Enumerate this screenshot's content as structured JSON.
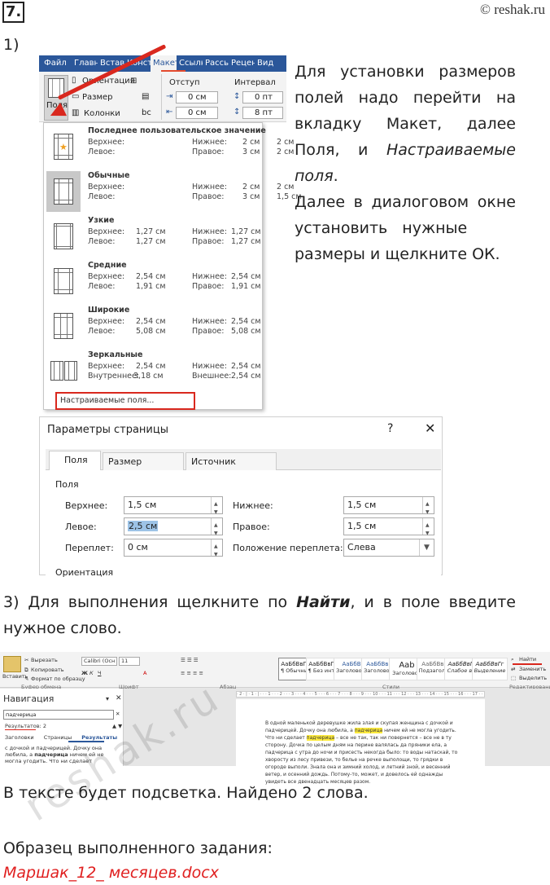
{
  "header": {
    "task_number": "7.",
    "site": "© reshak.ru"
  },
  "part1": {
    "label": "1)",
    "ribbon": {
      "tabs": [
        "Файл",
        "Главн",
        "Встав",
        "Конст",
        "Макет",
        "Ссылк",
        "Рассы",
        "Рецен",
        "Вид"
      ],
      "selected_tab": "Макет",
      "orientation": "Ориентация",
      "size": "Размер",
      "columns": "Колонки",
      "fields": "Поля",
      "indent": "Отступ",
      "spacing": "Интервал",
      "indent_left": "0 см",
      "indent_right": "0 см",
      "spacing_before": "0 пт",
      "spacing_after": "8 пт"
    },
    "margins_menu": {
      "items": [
        {
          "title": "Последнее пользовательское значение",
          "top_label": "Верхнее:",
          "top": "2 см",
          "bottom_label": "Нижнее:",
          "bottom": "2 см",
          "left_label": "Левое:",
          "left": "3 см",
          "right_label": "Правое:",
          "right": "2 см"
        },
        {
          "title": "Обычные",
          "top_label": "Верхнее:",
          "top": "2 см",
          "bottom_label": "Нижнее:",
          "bottom": "2 см",
          "left_label": "Левое:",
          "left": "3 см",
          "right_label": "Правое:",
          "right": "1,5 см"
        },
        {
          "title": "Узкие",
          "top_label": "Верхнее:",
          "top": "1,27 см",
          "bottom_label": "Нижнее:",
          "bottom": "1,27 см",
          "left_label": "Левое:",
          "left": "1,27 см",
          "right_label": "Правое:",
          "right": "1,27 см"
        },
        {
          "title": "Средние",
          "top_label": "Верхнее:",
          "top": "2,54 см",
          "bottom_label": "Нижнее:",
          "bottom": "2,54 см",
          "left_label": "Левое:",
          "left": "1,91 см",
          "right_label": "Правое:",
          "right": "1,91 см"
        },
        {
          "title": "Широкие",
          "top_label": "Верхнее:",
          "top": "2,54 см",
          "bottom_label": "Нижнее:",
          "bottom": "2,54 см",
          "left_label": "Левое:",
          "left": "5,08 см",
          "right_label": "Правое:",
          "right": "5,08 см"
        },
        {
          "title": "Зеркальные",
          "top_label": "Верхнее:",
          "top": "2,54 см",
          "bottom_label": "Нижнее:",
          "bottom": "2,54 см",
          "left_label": "Внутреннее:",
          "left": "3,18 см",
          "right_label": "Внешнее:",
          "right": "2,54 см"
        }
      ],
      "custom": "Настраиваемые поля..."
    },
    "description": {
      "line1": "Для установки размеров",
      "line2": "полей надо перейти на",
      "line3": "вкладку Макет, далее",
      "line4_a": "Поля, и ",
      "line4_b": "Настраиваемые",
      "line5": "поля",
      "line5_tail": ".",
      "line6": "Далее в диалоговом окне",
      "line7": "установить нужные",
      "line8": "размеры и щелкните ОК."
    }
  },
  "dialog": {
    "title": "Параметры страницы",
    "help": "?",
    "close": "✕",
    "tabs": [
      "Поля",
      "Размер бумаги",
      "Источник бумаги"
    ],
    "section": "Поля",
    "top_label": "Верхнее:",
    "top_value": "1,5 см",
    "bottom_label": "Нижнее:",
    "bottom_value": "1,5 см",
    "left_label": "Левое:",
    "left_value": "2,5 см",
    "right_label": "Правое:",
    "right_value": "1,5 см",
    "gutter_label": "Переплет:",
    "gutter_value": "0 см",
    "gutter_pos_label": "Положение переплета:",
    "gutter_pos_value": "Слева",
    "orientation": "Ориентация"
  },
  "part3": {
    "text_a": "3) Для выполнения щелкните по ",
    "text_bold": "Найти",
    "text_b": ", и в поле введите нужное слово."
  },
  "word": {
    "clipboard": {
      "paste": "Вставить",
      "cut": "Вырезать",
      "copy": "Копировать",
      "format": "Формат по образцу",
      "group": "Буфер обмена"
    },
    "font": {
      "name": "Calibri (Осн",
      "size": "11",
      "group": "Шрифт"
    },
    "paragraph_group": "Абзац",
    "styles": [
      {
        "sample": "АаБбВвГг,",
        "name": "¶ Обычный"
      },
      {
        "sample": "АаБбВвГг,",
        "name": "¶ Без инт..."
      },
      {
        "sample": "АаБбВ",
        "name": "Заголово..."
      },
      {
        "sample": "АаБбВвГ",
        "name": "Заголово..."
      },
      {
        "sample": "Ааb",
        "name": "Заголовок"
      },
      {
        "sample": "АаБбВвГ",
        "name": "Подзагол..."
      },
      {
        "sample": "АаБбВвГг",
        "name": "Слабое в..."
      },
      {
        "sample": "АаБбВвГг",
        "name": "Выделение"
      }
    ],
    "styles_group": "Стили",
    "editing": {
      "find": "Найти",
      "replace": "Заменить",
      "select": "Выделить",
      "group": "Редактирование"
    },
    "nav": {
      "title": "Навигация",
      "query": "падчерица",
      "results": "Результатов: 2",
      "tabs": [
        "Заголовки",
        "Страницы",
        "Результаты"
      ],
      "snippet_a": "с дочкой и падчерицей. Дочку она любила, а",
      "snippet_b": "падчерица",
      "snippet_c": "ничем ей не могла угодить. Что ни сделает"
    },
    "ruler": "· 2 · | · 1 · | · · · 1 · · · 2 · · · 3 · · · 4 · · · 5 · · · 6 · · · 7 · · · 8 · · · 9 · · · 10 · · · 11 · · · 12 · · · 13 · · · 14 · · · 15 · · · 16 · · · 17 · · · 18",
    "doc": {
      "t1": "В одной маленькой деревушке жила злая и скупая женщина с дочкой и падчерицей. Дочку она любила, а ",
      "m1": "падчерица",
      "t2": " ничем ей не могла угодить. Что ни сделает ",
      "m2": "падчерица",
      "t3": " – все не так, так ни повернется – все не в ту сторону. Дочка по целым дням на перине валялась да пряники ела, а падчерица с утра до ночи и присесть некогда было: то воды натаскай, то хворосту из лесу привези, то белье на речке выполощи, то грядки в огороде выполи. Знала она и зимний холод, и летний зной, и весенний ветер, и осенний дождь. Потому-то, может, и довелось ей однажды увидеть все двенадцать месяцев разом."
    }
  },
  "after": "В тексте будет подсветка. Найдено 2 слова.",
  "sample_label": "Образец выполненного задания:",
  "filename": "Маршак_12_ месяцев.docx",
  "watermark": "reshak.ru",
  "colors": {
    "ribbon_blue": "#2b579a",
    "accent_red": "#d9281e",
    "highlight": "#ffec3d",
    "filename_red": "#e02020"
  }
}
